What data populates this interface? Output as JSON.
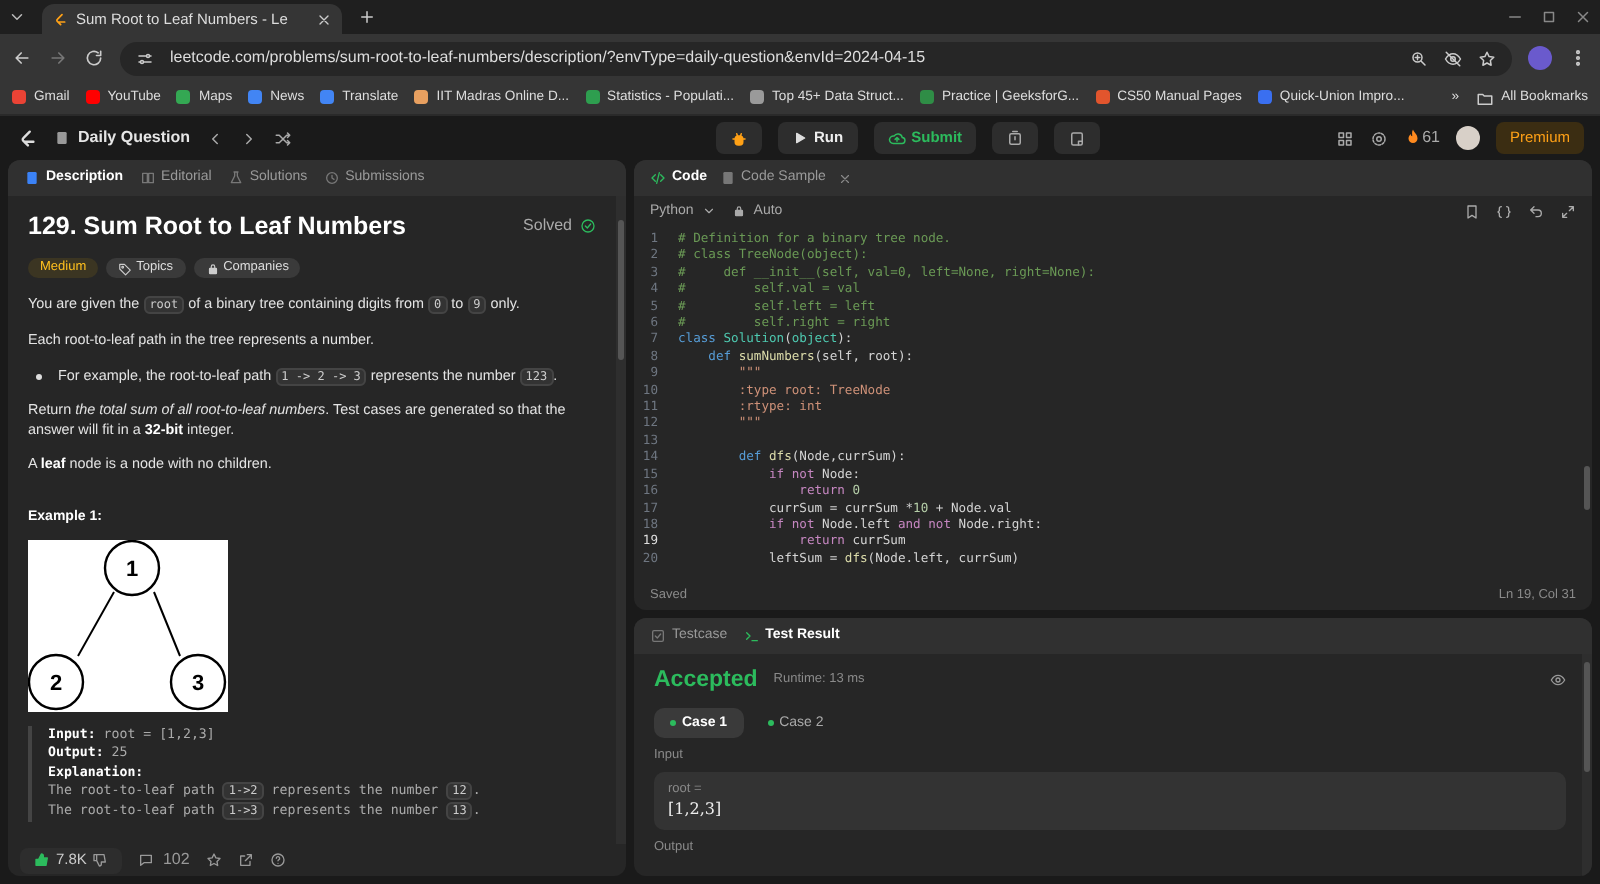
{
  "browser": {
    "tab": {
      "title": "Sum Root to Leaf Numbers - Le"
    },
    "url": "leetcode.com/problems/sum-root-to-leaf-numbers/description/?envType=daily-question&envId=2024-04-15",
    "bookmarks": [
      {
        "label": "Gmail",
        "color": "#ea4335"
      },
      {
        "label": "YouTube",
        "color": "#ff0000"
      },
      {
        "label": "Maps",
        "color": "#34a853"
      },
      {
        "label": "News",
        "color": "#4285f4"
      },
      {
        "label": "Translate",
        "color": "#4285f4"
      },
      {
        "label": "IIT Madras Online D...",
        "color": "#e8a060"
      },
      {
        "label": "Statistics - Populati...",
        "color": "#2e9e4f"
      },
      {
        "label": "Top 45+ Data Struct...",
        "color": "#9a9a9a"
      },
      {
        "label": "Practice | GeeksforG...",
        "color": "#2f8d46"
      },
      {
        "label": "CS50 Manual Pages",
        "color": "#e2552d"
      },
      {
        "label": "Quick-Union Impro...",
        "color": "#3a6ff0"
      }
    ],
    "overflow": "»",
    "all_bookmarks": "All Bookmarks"
  },
  "topbar": {
    "title": "Daily Question",
    "run": "Run",
    "submit": "Submit",
    "streak": "61",
    "premium": "Premium"
  },
  "description": {
    "tabs": [
      {
        "label": "Description",
        "selected": true
      },
      {
        "label": "Editorial",
        "selected": false
      },
      {
        "label": "Solutions",
        "selected": false
      },
      {
        "label": "Submissions",
        "selected": false
      }
    ],
    "title": "129. Sum Root to Leaf Numbers",
    "status": "Solved",
    "tags": [
      {
        "label": "Medium",
        "kind": "difficulty"
      },
      {
        "label": "Topics",
        "kind": "topics"
      },
      {
        "label": "Companies",
        "kind": "companies"
      }
    ],
    "paragraphs": [
      {
        "kind": "text",
        "parts": [
          {
            "kind": "text",
            "text": "You are given the "
          },
          {
            "kind": "code",
            "text": "root"
          },
          {
            "kind": "text",
            "text": " of a binary tree containing digits from "
          },
          {
            "kind": "code",
            "text": "0"
          },
          {
            "kind": "text",
            "text": " to "
          },
          {
            "kind": "code",
            "text": "9"
          },
          {
            "kind": "text",
            "text": " only."
          }
        ]
      },
      {
        "kind": "text",
        "parts": [
          {
            "kind": "text",
            "text": "Each root-to-leaf path in the tree represents a number."
          }
        ]
      },
      {
        "kind": "bullet",
        "parts": [
          {
            "kind": "text",
            "text": "For example, the root-to-leaf path "
          },
          {
            "kind": "code",
            "text": "1 -> 2 -> 3"
          },
          {
            "kind": "text",
            "text": " represents the number "
          },
          {
            "kind": "code",
            "text": "123"
          },
          {
            "kind": "text",
            "text": "."
          }
        ]
      },
      {
        "kind": "text",
        "parts": [
          {
            "kind": "text",
            "text": "Return *the total sum of all root-to-leaf numbers*. Test cases are generated so that the answer will fit in a **32-bit** integer."
          }
        ]
      },
      {
        "kind": "text",
        "parts": [
          {
            "kind": "text",
            "text": "A **leaf** node is a node with no children."
          }
        ]
      }
    ],
    "example": {
      "heading": "Example 1:",
      "tree": {
        "nodes": [
          "1",
          "2",
          "3"
        ]
      },
      "lines": [
        [
          {
            "kind": "text",
            "text": "**Input:** root = [1,2,3]"
          }
        ],
        [
          {
            "kind": "text",
            "text": "**Output:** 25"
          }
        ],
        [
          {
            "kind": "text",
            "text": "**Explanation:**"
          }
        ],
        [
          {
            "kind": "text",
            "text": "The root-to-leaf path "
          },
          {
            "kind": "code",
            "text": "1->2"
          },
          {
            "kind": "text",
            "text": " represents the number "
          },
          {
            "kind": "code",
            "text": "12"
          },
          {
            "kind": "text",
            "text": "."
          }
        ],
        [
          {
            "kind": "text",
            "text": "The root-to-leaf path "
          },
          {
            "kind": "code",
            "text": "1->3"
          },
          {
            "kind": "text",
            "text": " represents the number "
          },
          {
            "kind": "code",
            "text": "13"
          },
          {
            "kind": "text",
            "text": "."
          }
        ]
      ]
    },
    "footer": {
      "likes": "7.8K",
      "comments": "102"
    }
  },
  "editor": {
    "tabs": [
      {
        "label": "Code",
        "selected": true
      },
      {
        "label": "Code Sample",
        "selected": false
      }
    ],
    "language": "Python",
    "mode": "Auto",
    "lines": [
      {
        "num": "1",
        "active": false,
        "tokens": [
          {
            "kind": "comment",
            "text": "# Definition for a binary tree node."
          }
        ]
      },
      {
        "num": "2",
        "active": false,
        "tokens": [
          {
            "kind": "comment",
            "text": "# class TreeNode(object):"
          }
        ]
      },
      {
        "num": "3",
        "active": false,
        "tokens": [
          {
            "kind": "comment",
            "text": "#     def __init__(self, val=0, left=None, right=None):"
          }
        ]
      },
      {
        "num": "4",
        "active": false,
        "tokens": [
          {
            "kind": "comment",
            "text": "#         self.val = val"
          }
        ]
      },
      {
        "num": "5",
        "active": false,
        "tokens": [
          {
            "kind": "comment",
            "text": "#         self.left = left"
          }
        ]
      },
      {
        "num": "6",
        "active": false,
        "tokens": [
          {
            "kind": "comment",
            "text": "#         self.right = right"
          }
        ]
      },
      {
        "num": "7",
        "active": false,
        "tokens": [
          {
            "kind": "keyword",
            "text": "class"
          },
          {
            "kind": "type",
            "text": " Solution"
          },
          {
            "kind": "plain",
            "text": "("
          },
          {
            "kind": "type",
            "text": "object"
          },
          {
            "kind": "plain",
            "text": "):"
          }
        ]
      },
      {
        "num": "8",
        "active": false,
        "tokens": [
          {
            "kind": "keyword",
            "text": "    def"
          },
          {
            "kind": "function",
            "text": " sumNumbers"
          },
          {
            "kind": "plain",
            "text": "(self, root):"
          }
        ]
      },
      {
        "num": "9",
        "active": false,
        "tokens": [
          {
            "kind": "string",
            "text": "        \"\"\""
          }
        ]
      },
      {
        "num": "10",
        "active": false,
        "tokens": [
          {
            "kind": "string",
            "text": "        :type root: TreeNode"
          }
        ]
      },
      {
        "num": "11",
        "active": false,
        "tokens": [
          {
            "kind": "string",
            "text": "        :rtype: int"
          }
        ]
      },
      {
        "num": "12",
        "active": false,
        "tokens": [
          {
            "kind": "string",
            "text": "        \"\"\""
          }
        ]
      },
      {
        "num": "13",
        "active": false
      },
      {
        "num": "14",
        "active": false,
        "tokens": [
          {
            "kind": "keyword",
            "text": "        def"
          },
          {
            "kind": "function",
            "text": " dfs"
          },
          {
            "kind": "plain",
            "text": "(Node,currSum):"
          }
        ]
      },
      {
        "num": "15",
        "active": false,
        "tokens": [
          {
            "kind": "control",
            "text": "            if not"
          },
          {
            "kind": "plain",
            "text": " Node:"
          }
        ]
      },
      {
        "num": "16",
        "active": false,
        "tokens": [
          {
            "kind": "control",
            "text": "                return"
          },
          {
            "kind": "number",
            "text": " 0"
          }
        ]
      },
      {
        "num": "17",
        "active": false,
        "tokens": [
          {
            "kind": "plain",
            "text": "            currSum = currSum *"
          },
          {
            "kind": "number",
            "text": "10"
          },
          {
            "kind": "plain",
            "text": " + Node.val"
          }
        ]
      },
      {
        "num": "18",
        "active": false,
        "tokens": [
          {
            "kind": "control",
            "text": "            if not"
          },
          {
            "kind": "plain",
            "text": " Node.left "
          },
          {
            "kind": "control",
            "text": "and not"
          },
          {
            "kind": "plain",
            "text": " Node.right:"
          }
        ]
      },
      {
        "num": "19",
        "active": true,
        "tokens": [
          {
            "kind": "control",
            "text": "                return"
          },
          {
            "kind": "plain",
            "text": " currSum"
          }
        ]
      },
      {
        "num": "20",
        "active": false,
        "tokens": [
          {
            "kind": "plain",
            "text": "            leftSum = "
          },
          {
            "kind": "function",
            "text": "dfs"
          },
          {
            "kind": "plain",
            "text": "(Node.left, currSum)"
          }
        ]
      }
    ],
    "status": "Saved",
    "cursor": "Ln 19, Col 31"
  },
  "test_result": {
    "tabs": [
      {
        "label": "Testcase",
        "selected": false
      },
      {
        "label": "Test Result",
        "selected": true
      }
    ],
    "verdict": "Accepted",
    "runtime": "Runtime: 13 ms",
    "cases": [
      {
        "label": "Case 1",
        "selected": true
      },
      {
        "label": "Case 2",
        "selected": false
      }
    ],
    "input_label": "Input",
    "inputs": [
      {
        "name": "root =",
        "value": "[1,2,3]"
      }
    ],
    "output_label": "Output"
  }
}
